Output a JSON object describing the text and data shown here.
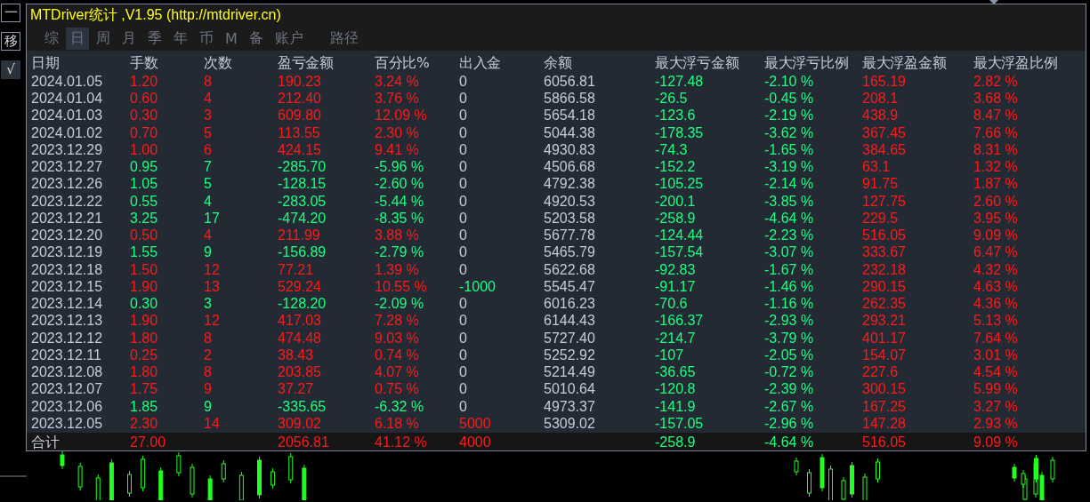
{
  "window": {
    "title": "MTDriver统计 ,V1.95 (http://mtdriver.cn)"
  },
  "side_buttons": [
    {
      "label": "一",
      "kind": "outline"
    },
    {
      "label": "移",
      "kind": "outline"
    },
    {
      "label": "√",
      "kind": "filled"
    }
  ],
  "tabs": [
    {
      "label": "综",
      "selected": false
    },
    {
      "label": "日",
      "selected": true
    },
    {
      "label": "周",
      "selected": false
    },
    {
      "label": "月",
      "selected": false
    },
    {
      "label": "季",
      "selected": false
    },
    {
      "label": "年",
      "selected": false
    },
    {
      "label": "币",
      "selected": false
    },
    {
      "label": "M",
      "selected": false
    },
    {
      "label": "备",
      "selected": false
    },
    {
      "label": "账户",
      "selected": false
    },
    {
      "label": "路径",
      "selected": false
    }
  ],
  "table": {
    "columns": [
      "日期",
      "手数",
      "次数",
      "盈亏金额",
      "百分比%",
      "出入金",
      "余额",
      "最大浮亏金额",
      "最大浮亏比例",
      "最大浮盈金额",
      "最大浮盈比例"
    ],
    "rows": [
      {
        "cells": [
          "2024.01.05",
          "1.20",
          "8",
          "190.23",
          "3.24 %",
          "0",
          "6056.81",
          "-127.48",
          "-2.10 %",
          "165.19",
          "2.82 %"
        ],
        "loss": false,
        "deposit": false,
        "withdrawal": false
      },
      {
        "cells": [
          "2024.01.04",
          "0.60",
          "4",
          "212.40",
          "3.76 %",
          "0",
          "5866.58",
          "-26.5",
          "-0.45 %",
          "208.1",
          "3.68 %"
        ],
        "loss": false,
        "deposit": false,
        "withdrawal": false
      },
      {
        "cells": [
          "2024.01.03",
          "0.30",
          "3",
          "609.80",
          "12.09 %",
          "0",
          "5654.18",
          "-123.6",
          "-2.19 %",
          "438.9",
          "8.47 %"
        ],
        "loss": false,
        "deposit": false,
        "withdrawal": false
      },
      {
        "cells": [
          "2024.01.02",
          "0.70",
          "5",
          "113.55",
          "2.30 %",
          "0",
          "5044.38",
          "-178.35",
          "-3.62 %",
          "367.45",
          "7.66 %"
        ],
        "loss": false,
        "deposit": false,
        "withdrawal": false
      },
      {
        "cells": [
          "2023.12.29",
          "1.00",
          "6",
          "424.15",
          "9.41 %",
          "0",
          "4930.83",
          "-74.3",
          "-1.65 %",
          "384.65",
          "8.31 %"
        ],
        "loss": false,
        "deposit": false,
        "withdrawal": false
      },
      {
        "cells": [
          "2023.12.27",
          "0.95",
          "7",
          "-285.70",
          "-5.96 %",
          "0",
          "4506.68",
          "-152.2",
          "-3.19 %",
          "63.1",
          "1.32 %"
        ],
        "loss": true,
        "deposit": false,
        "withdrawal": false
      },
      {
        "cells": [
          "2023.12.26",
          "1.05",
          "5",
          "-128.15",
          "-2.60 %",
          "0",
          "4792.38",
          "-105.25",
          "-2.14 %",
          "91.75",
          "1.87 %"
        ],
        "loss": true,
        "deposit": false,
        "withdrawal": false
      },
      {
        "cells": [
          "2023.12.22",
          "0.55",
          "4",
          "-283.05",
          "-5.44 %",
          "0",
          "4920.53",
          "-200.1",
          "-3.85 %",
          "127.75",
          "2.60 %"
        ],
        "loss": true,
        "deposit": false,
        "withdrawal": false
      },
      {
        "cells": [
          "2023.12.21",
          "3.25",
          "17",
          "-474.20",
          "-8.35 %",
          "0",
          "5203.58",
          "-258.9",
          "-4.64 %",
          "229.5",
          "3.95 %"
        ],
        "loss": true,
        "deposit": false,
        "withdrawal": false
      },
      {
        "cells": [
          "2023.12.20",
          "0.50",
          "4",
          "211.99",
          "3.88 %",
          "0",
          "5677.78",
          "-124.44",
          "-2.23 %",
          "516.05",
          "9.09 %"
        ],
        "loss": false,
        "deposit": false,
        "withdrawal": false
      },
      {
        "cells": [
          "2023.12.19",
          "1.55",
          "9",
          "-156.89",
          "-2.79 %",
          "0",
          "5465.79",
          "-157.54",
          "-3.07 %",
          "333.67",
          "6.47 %"
        ],
        "loss": true,
        "deposit": false,
        "withdrawal": false
      },
      {
        "cells": [
          "2023.12.18",
          "1.50",
          "12",
          "77.21",
          "1.39 %",
          "0",
          "5622.68",
          "-92.83",
          "-1.67 %",
          "232.18",
          "4.32 %"
        ],
        "loss": false,
        "deposit": false,
        "withdrawal": false
      },
      {
        "cells": [
          "2023.12.15",
          "1.90",
          "13",
          "529.24",
          "10.55 %",
          "-1000",
          "5545.47",
          "-91.17",
          "-1.46 %",
          "290.15",
          "4.63 %"
        ],
        "loss": false,
        "deposit": false,
        "withdrawal": true
      },
      {
        "cells": [
          "2023.12.14",
          "0.30",
          "3",
          "-128.20",
          "-2.09 %",
          "0",
          "6016.23",
          "-70.6",
          "-1.16 %",
          "262.35",
          "4.36 %"
        ],
        "loss": true,
        "deposit": false,
        "withdrawal": false
      },
      {
        "cells": [
          "2023.12.13",
          "1.90",
          "12",
          "417.03",
          "7.28 %",
          "0",
          "6144.43",
          "-166.37",
          "-2.93 %",
          "293.21",
          "5.13 %"
        ],
        "loss": false,
        "deposit": false,
        "withdrawal": false
      },
      {
        "cells": [
          "2023.12.12",
          "1.80",
          "8",
          "474.48",
          "9.03 %",
          "0",
          "5727.40",
          "-214.7",
          "-3.79 %",
          "401.17",
          "7.64 %"
        ],
        "loss": false,
        "deposit": false,
        "withdrawal": false
      },
      {
        "cells": [
          "2023.12.11",
          "0.25",
          "2",
          "38.43",
          "0.74 %",
          "0",
          "5252.92",
          "-107",
          "-2.05 %",
          "154.07",
          "3.01 %"
        ],
        "loss": false,
        "deposit": false,
        "withdrawal": false
      },
      {
        "cells": [
          "2023.12.08",
          "1.80",
          "8",
          "203.85",
          "4.07 %",
          "0",
          "5214.49",
          "-36.65",
          "-0.72 %",
          "227.6",
          "4.54 %"
        ],
        "loss": false,
        "deposit": false,
        "withdrawal": false
      },
      {
        "cells": [
          "2023.12.07",
          "1.75",
          "9",
          "37.27",
          "0.75 %",
          "0",
          "5010.64",
          "-120.8",
          "-2.39 %",
          "300.15",
          "5.99 %"
        ],
        "loss": false,
        "deposit": false,
        "withdrawal": false
      },
      {
        "cells": [
          "2023.12.06",
          "1.85",
          "9",
          "-335.65",
          "-6.32 %",
          "0",
          "4973.37",
          "-141.9",
          "-2.67 %",
          "167.25",
          "3.27 %"
        ],
        "loss": true,
        "deposit": false,
        "withdrawal": false
      },
      {
        "cells": [
          "2023.12.05",
          "2.30",
          "14",
          "309.02",
          "6.18 %",
          "5000",
          "5309.02",
          "-157.05",
          "-2.96 %",
          "147.28",
          "2.93 %"
        ],
        "loss": false,
        "deposit": true,
        "withdrawal": false
      }
    ],
    "total": {
      "cells": [
        "合计",
        "27.00",
        "",
        "2056.81",
        "41.12 %",
        "4000",
        "",
        "-258.9",
        "-4.64 %",
        "516.05",
        "9.09 %"
      ],
      "loss": false,
      "deposit": true,
      "withdrawal": false
    }
  }
}
